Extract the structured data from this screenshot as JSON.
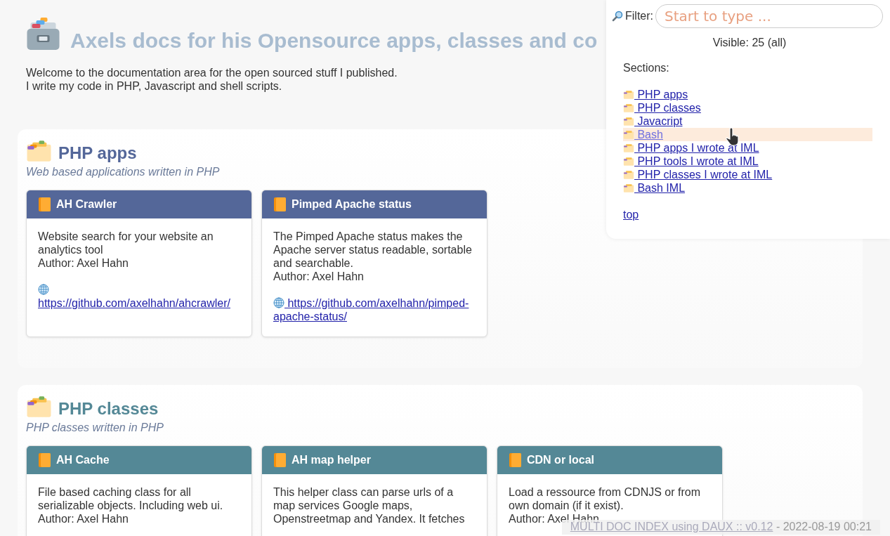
{
  "page": {
    "title": "Axels docs for his Opensource apps, classes and co",
    "intro": [
      "Welcome to the documentation area for the open sourced stuff I published.",
      "I write my code in PHP, Javascript and shell scripts."
    ]
  },
  "sections": [
    {
      "title": "PHP apps",
      "subtitle": "Web based applications written in PHP",
      "color": "#546799",
      "cards": [
        {
          "title": "AH Crawler",
          "lines": [
            "Website search for your website an",
            "analytics tool",
            "Author: Axel Hahn"
          ],
          "link": "https://github.com/axelhahn/ahcrawler/"
        },
        {
          "title": "Pimped Apache status",
          "lines": [
            "The Pimped Apache status makes the",
            "Apache server status readable, sortable",
            "and searchable.",
            "Author: Axel Hahn"
          ],
          "link": "https://github.com/axelhahn/pimped-apache-status/"
        }
      ]
    },
    {
      "title": "PHP classes",
      "subtitle": "PHP classes written in PHP",
      "color": "#548896",
      "cards": [
        {
          "title": "AH Cache",
          "lines": [
            "File based caching class for all",
            "serializable objects. Including web ui.",
            "Author: Axel Hahn"
          ]
        },
        {
          "title": "AH map helper",
          "lines": [
            "This helper class can parse urls of a",
            "map services Google maps,",
            "Openstreetmap and Yandex. It fetches"
          ]
        },
        {
          "title": "CDN or local",
          "lines": [
            "Load a ressource from CDNJS or from",
            "own domain (if it exist).",
            "Author: Axel Hahn"
          ]
        }
      ]
    }
  ],
  "filter": {
    "label": "Filter:",
    "placeholder": "Start to type ...",
    "visible": "Visible: 25 (all)",
    "sections_label": "Sections:",
    "links": [
      {
        "label": " PHP apps",
        "selected": false
      },
      {
        "label": " PHP classes",
        "selected": false
      },
      {
        "label": " Javacript",
        "selected": false
      },
      {
        "label": " Bash",
        "selected": true
      },
      {
        "label": " PHP apps I wrote at IML",
        "selected": false
      },
      {
        "label": " PHP tools I wrote at IML",
        "selected": false
      },
      {
        "label": " PHP classes I wrote at IML",
        "selected": false
      },
      {
        "label": " Bash IML",
        "selected": false
      }
    ],
    "top": "top"
  },
  "footer": {
    "link": "MULTI DOC INDEX using DAUX :: v0.12",
    "date": " - 2022-08-19 00:21"
  }
}
